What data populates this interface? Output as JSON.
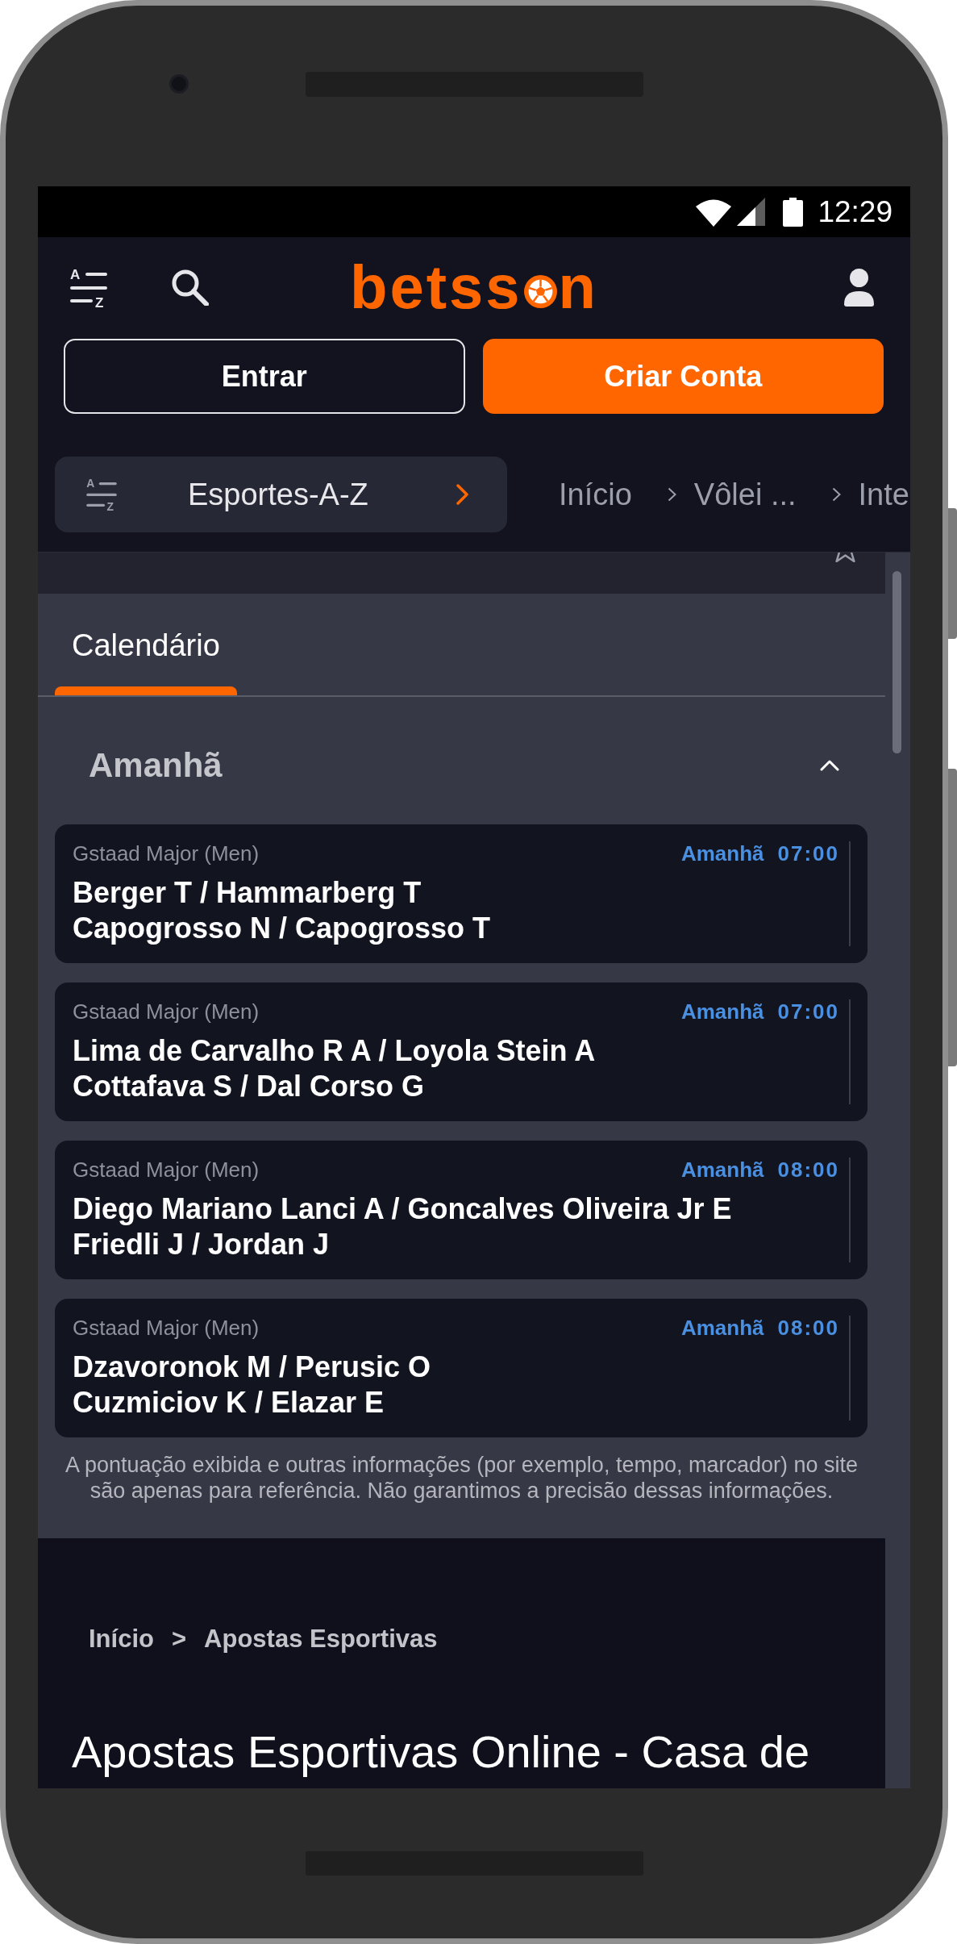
{
  "status_bar": {
    "time": "12:29"
  },
  "header": {
    "sort_icon_letters": [
      "A",
      "Z"
    ],
    "logo": {
      "start": "betss",
      "end": "n"
    },
    "buttons": [
      {
        "label": "Entrar",
        "kind": "outline"
      },
      {
        "label": "Criar Conta",
        "kind": "primary"
      }
    ]
  },
  "nav": {
    "sports_button": {
      "label": "Esportes-A-Z",
      "icon_letters": [
        "A",
        "Z"
      ]
    },
    "breadcrumb": [
      "Início",
      "Vôlei ...",
      "Inte"
    ]
  },
  "tabs": [
    {
      "label": "Calendário",
      "selected": true
    }
  ],
  "section": {
    "title": "Amanhã",
    "expanded": true,
    "matches": [
      {
        "league": "Gstaad Major (Men)",
        "day": "Amanhã",
        "time": "07:00",
        "teams": [
          "Berger T / Hammarberg T",
          "Capogrosso N / Capogrosso T"
        ]
      },
      {
        "league": "Gstaad Major (Men)",
        "day": "Amanhã",
        "time": "07:00",
        "teams": [
          "Lima de Carvalho R A / Loyola Stein A",
          "Cottafava S / Dal Corso G"
        ]
      },
      {
        "league": "Gstaad Major (Men)",
        "day": "Amanhã",
        "time": "08:00",
        "teams": [
          "Diego Mariano Lanci A / Goncalves Oliveira Jr E",
          "Friedli J / Jordan J"
        ]
      },
      {
        "league": "Gstaad Major (Men)",
        "day": "Amanhã",
        "time": "08:00",
        "teams": [
          "Dzavoronok M / Perusic O",
          "Cuzmiciov K / Elazar E"
        ]
      }
    ]
  },
  "disclaimer": "A pontuação exibida e outras informações (por exemplo, tempo, marcador) no site são apenas para referência. Não garantimos a precisão dessas informações.",
  "footer": {
    "breadcrumb": [
      "Início",
      "Apostas Esportivas"
    ],
    "separator": ">",
    "title": "Apostas Esportivas Online - Casa de"
  }
}
